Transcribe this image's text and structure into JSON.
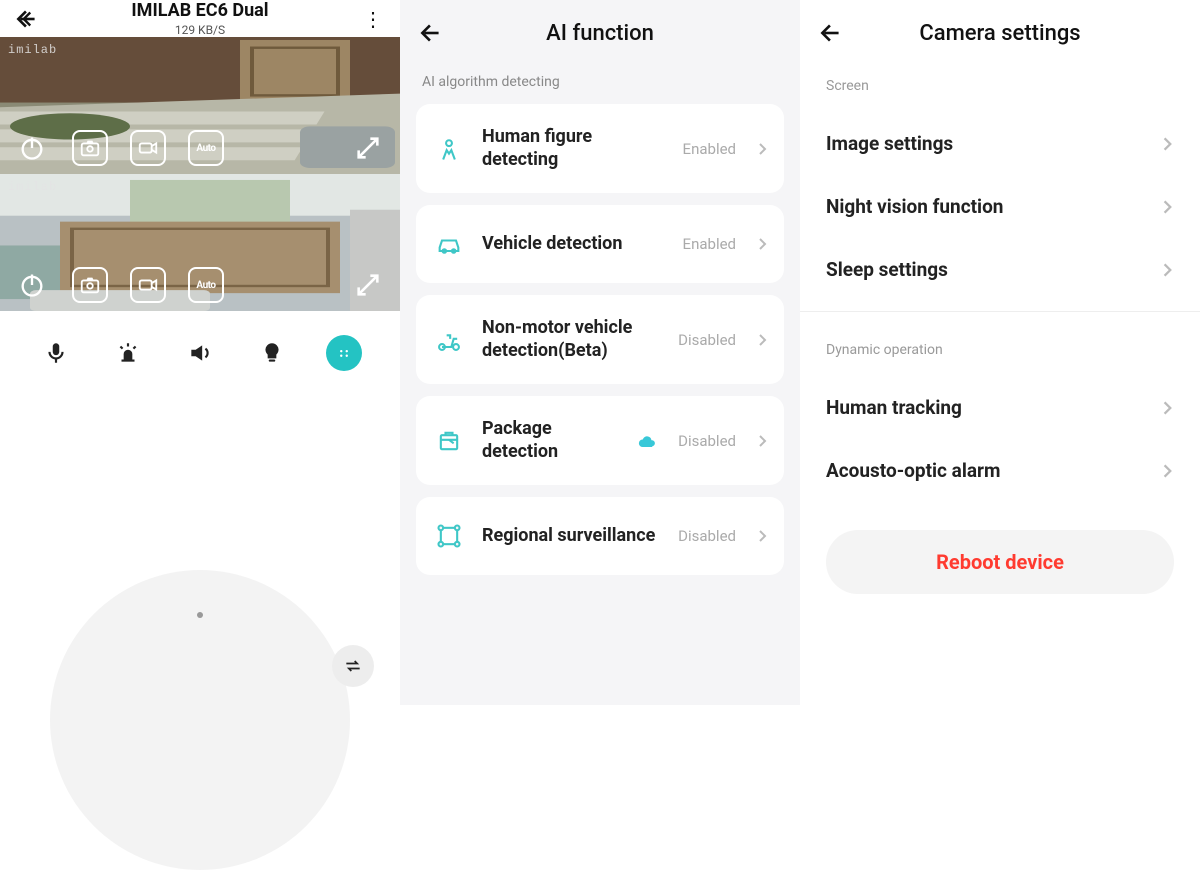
{
  "panelA": {
    "title": "IMILAB EC6 Dual",
    "subtitle": "129 KB/S",
    "watermark": "imilab",
    "autoLabel": "Auto"
  },
  "panelB": {
    "title": "AI function",
    "sectionLabel": "AI algorithm detecting",
    "items": [
      {
        "label": "Human figure detecting",
        "state": "Enabled",
        "cloud": false
      },
      {
        "label": "Vehicle detection",
        "state": "Enabled",
        "cloud": false
      },
      {
        "label": "Non-motor vehicle detection(Beta)",
        "state": "Disabled",
        "cloud": false
      },
      {
        "label": "Package detection",
        "state": "Disabled",
        "cloud": true
      },
      {
        "label": "Regional surveillance",
        "state": "Disabled",
        "cloud": false
      }
    ]
  },
  "panelC": {
    "title": "Camera settings",
    "groups": [
      {
        "label": "Screen",
        "rows": [
          "Image settings",
          "Night vision function",
          "Sleep settings"
        ]
      },
      {
        "label": "Dynamic operation",
        "rows": [
          "Human tracking",
          "Acousto-optic alarm"
        ]
      }
    ],
    "reboot": "Reboot device"
  }
}
